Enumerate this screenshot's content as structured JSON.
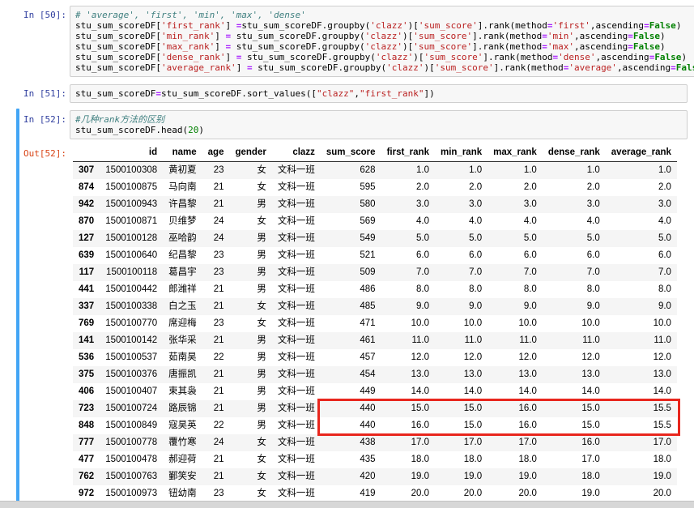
{
  "theme": {
    "input-prompt": "#303F9F",
    "output-prompt": "#D84315",
    "selected-bar": "#42A5F5",
    "cell-bg": "#f7f7f7",
    "cell-border": "#cfcfcf",
    "stripe": "#f5f5f5",
    "comment": "#408080",
    "string": "#BA2121",
    "keyword": "#008000",
    "operator": "#AA22FF",
    "number": "#008000",
    "highlight": "#e8261d"
  },
  "cells": [
    {
      "prompt": "In [50]:",
      "lines": [
        [
          [
            "com",
            "# 'average', 'first', 'min', 'max', 'dense'"
          ]
        ],
        [
          [
            "pl",
            "stu_sum_scoreDF["
          ],
          [
            "str",
            "'first_rank'"
          ],
          [
            "pl",
            "] "
          ],
          [
            "op",
            "="
          ],
          [
            "pl",
            "stu_sum_scoreDF.groupby("
          ],
          [
            "str",
            "'clazz'"
          ],
          [
            "pl",
            ")["
          ],
          [
            "str",
            "'sum_score'"
          ],
          [
            "pl",
            "].rank(method"
          ],
          [
            "op",
            "="
          ],
          [
            "str",
            "'first'"
          ],
          [
            "pl",
            ",ascending"
          ],
          [
            "op",
            "="
          ],
          [
            "kw",
            "False"
          ],
          [
            "pl",
            ")"
          ]
        ],
        [
          [
            "pl",
            "stu_sum_scoreDF["
          ],
          [
            "str",
            "'min_rank'"
          ],
          [
            "pl",
            "] "
          ],
          [
            "op",
            "="
          ],
          [
            "pl",
            " stu_sum_scoreDF.groupby("
          ],
          [
            "str",
            "'clazz'"
          ],
          [
            "pl",
            ")["
          ],
          [
            "str",
            "'sum_score'"
          ],
          [
            "pl",
            "].rank(method"
          ],
          [
            "op",
            "="
          ],
          [
            "str",
            "'min'"
          ],
          [
            "pl",
            ",ascending"
          ],
          [
            "op",
            "="
          ],
          [
            "kw",
            "False"
          ],
          [
            "pl",
            ")"
          ]
        ],
        [
          [
            "pl",
            "stu_sum_scoreDF["
          ],
          [
            "str",
            "'max_rank'"
          ],
          [
            "pl",
            "] "
          ],
          [
            "op",
            "="
          ],
          [
            "pl",
            " stu_sum_scoreDF.groupby("
          ],
          [
            "str",
            "'clazz'"
          ],
          [
            "pl",
            ")["
          ],
          [
            "str",
            "'sum_score'"
          ],
          [
            "pl",
            "].rank(method"
          ],
          [
            "op",
            "="
          ],
          [
            "str",
            "'max'"
          ],
          [
            "pl",
            ",ascending"
          ],
          [
            "op",
            "="
          ],
          [
            "kw",
            "False"
          ],
          [
            "pl",
            ")"
          ]
        ],
        [
          [
            "pl",
            "stu_sum_scoreDF["
          ],
          [
            "str",
            "'dense_rank'"
          ],
          [
            "pl",
            "] "
          ],
          [
            "op",
            "="
          ],
          [
            "pl",
            " stu_sum_scoreDF.groupby("
          ],
          [
            "str",
            "'clazz'"
          ],
          [
            "pl",
            ")["
          ],
          [
            "str",
            "'sum_score'"
          ],
          [
            "pl",
            "].rank(method"
          ],
          [
            "op",
            "="
          ],
          [
            "str",
            "'dense'"
          ],
          [
            "pl",
            ",ascending"
          ],
          [
            "op",
            "="
          ],
          [
            "kw",
            "False"
          ],
          [
            "pl",
            ")"
          ]
        ],
        [
          [
            "pl",
            "stu_sum_scoreDF["
          ],
          [
            "str",
            "'average_rank'"
          ],
          [
            "pl",
            "] "
          ],
          [
            "op",
            "="
          ],
          [
            "pl",
            " stu_sum_scoreDF.groupby("
          ],
          [
            "str",
            "'clazz'"
          ],
          [
            "pl",
            ")["
          ],
          [
            "str",
            "'sum_score'"
          ],
          [
            "pl",
            "].rank(method"
          ],
          [
            "op",
            "="
          ],
          [
            "str",
            "'average'"
          ],
          [
            "pl",
            ",ascending"
          ],
          [
            "op",
            "="
          ],
          [
            "kw",
            "False"
          ],
          [
            "pl",
            ")"
          ]
        ]
      ]
    },
    {
      "prompt": "In [51]:",
      "lines": [
        [
          [
            "pl",
            "stu_sum_scoreDF"
          ],
          [
            "op",
            "="
          ],
          [
            "pl",
            "stu_sum_scoreDF.sort_values(["
          ],
          [
            "str",
            "\"clazz\""
          ],
          [
            "pl",
            ","
          ],
          [
            "str",
            "\"first_rank\""
          ],
          [
            "pl",
            "])"
          ]
        ]
      ]
    },
    {
      "prompt": "In [52]:",
      "lines": [
        [
          [
            "com",
            "#几种rank方法的区别"
          ]
        ],
        [
          [
            "pl",
            "stu_sum_scoreDF.head("
          ],
          [
            "num",
            "20"
          ],
          [
            "pl",
            ")"
          ]
        ]
      ],
      "output": {
        "prompt": "Out[52]:",
        "table": {
          "columns": [
            "",
            "id",
            "name",
            "age",
            "gender",
            "clazz",
            "sum_score",
            "first_rank",
            "min_rank",
            "max_rank",
            "dense_rank",
            "average_rank"
          ],
          "rows": [
            [
              "307",
              "1500100308",
              "黄初夏",
              "23",
              "女",
              "文科一班",
              "628",
              "1.0",
              "1.0",
              "1.0",
              "1.0",
              "1.0"
            ],
            [
              "874",
              "1500100875",
              "马向南",
              "21",
              "女",
              "文科一班",
              "595",
              "2.0",
              "2.0",
              "2.0",
              "2.0",
              "2.0"
            ],
            [
              "942",
              "1500100943",
              "许昌黎",
              "21",
              "男",
              "文科一班",
              "580",
              "3.0",
              "3.0",
              "3.0",
              "3.0",
              "3.0"
            ],
            [
              "870",
              "1500100871",
              "贝维梦",
              "24",
              "女",
              "文科一班",
              "569",
              "4.0",
              "4.0",
              "4.0",
              "4.0",
              "4.0"
            ],
            [
              "127",
              "1500100128",
              "巫哈韵",
              "24",
              "男",
              "文科一班",
              "549",
              "5.0",
              "5.0",
              "5.0",
              "5.0",
              "5.0"
            ],
            [
              "639",
              "1500100640",
              "纪昌黎",
              "23",
              "男",
              "文科一班",
              "521",
              "6.0",
              "6.0",
              "6.0",
              "6.0",
              "6.0"
            ],
            [
              "117",
              "1500100118",
              "葛昌宇",
              "23",
              "男",
              "文科一班",
              "509",
              "7.0",
              "7.0",
              "7.0",
              "7.0",
              "7.0"
            ],
            [
              "441",
              "1500100442",
              "郎潍祥",
              "21",
              "男",
              "文科一班",
              "486",
              "8.0",
              "8.0",
              "8.0",
              "8.0",
              "8.0"
            ],
            [
              "337",
              "1500100338",
              "白之玉",
              "21",
              "女",
              "文科一班",
              "485",
              "9.0",
              "9.0",
              "9.0",
              "9.0",
              "9.0"
            ],
            [
              "769",
              "1500100770",
              "席迎梅",
              "23",
              "女",
              "文科一班",
              "471",
              "10.0",
              "10.0",
              "10.0",
              "10.0",
              "10.0"
            ],
            [
              "141",
              "1500100142",
              "张华采",
              "21",
              "男",
              "文科一班",
              "461",
              "11.0",
              "11.0",
              "11.0",
              "11.0",
              "11.0"
            ],
            [
              "536",
              "1500100537",
              "茹南昊",
              "22",
              "男",
              "文科一班",
              "457",
              "12.0",
              "12.0",
              "12.0",
              "12.0",
              "12.0"
            ],
            [
              "375",
              "1500100376",
              "唐振凯",
              "21",
              "男",
              "文科一班",
              "454",
              "13.0",
              "13.0",
              "13.0",
              "13.0",
              "13.0"
            ],
            [
              "406",
              "1500100407",
              "束其袅",
              "21",
              "男",
              "文科一班",
              "449",
              "14.0",
              "14.0",
              "14.0",
              "14.0",
              "14.0"
            ],
            [
              "723",
              "1500100724",
              "路辰锦",
              "21",
              "男",
              "文科一班",
              "440",
              "15.0",
              "15.0",
              "16.0",
              "15.0",
              "15.5"
            ],
            [
              "848",
              "1500100849",
              "寇昊英",
              "22",
              "男",
              "文科一班",
              "440",
              "16.0",
              "15.0",
              "16.0",
              "15.0",
              "15.5"
            ],
            [
              "777",
              "1500100778",
              "覆竹寒",
              "24",
              "女",
              "文科一班",
              "438",
              "17.0",
              "17.0",
              "17.0",
              "16.0",
              "17.0"
            ],
            [
              "477",
              "1500100478",
              "郝迎荷",
              "21",
              "女",
              "文科一班",
              "435",
              "18.0",
              "18.0",
              "18.0",
              "17.0",
              "18.0"
            ],
            [
              "762",
              "1500100763",
              "鄞笑安",
              "21",
              "女",
              "文科一班",
              "420",
              "19.0",
              "19.0",
              "19.0",
              "18.0",
              "19.0"
            ],
            [
              "972",
              "1500100973",
              "钮幼南",
              "23",
              "女",
              "文科一班",
              "419",
              "20.0",
              "20.0",
              "20.0",
              "19.0",
              "20.0"
            ]
          ]
        },
        "highlight": {
          "row_start": 14,
          "row_end": 15,
          "col_start": 6,
          "col_end": 11
        }
      }
    }
  ]
}
